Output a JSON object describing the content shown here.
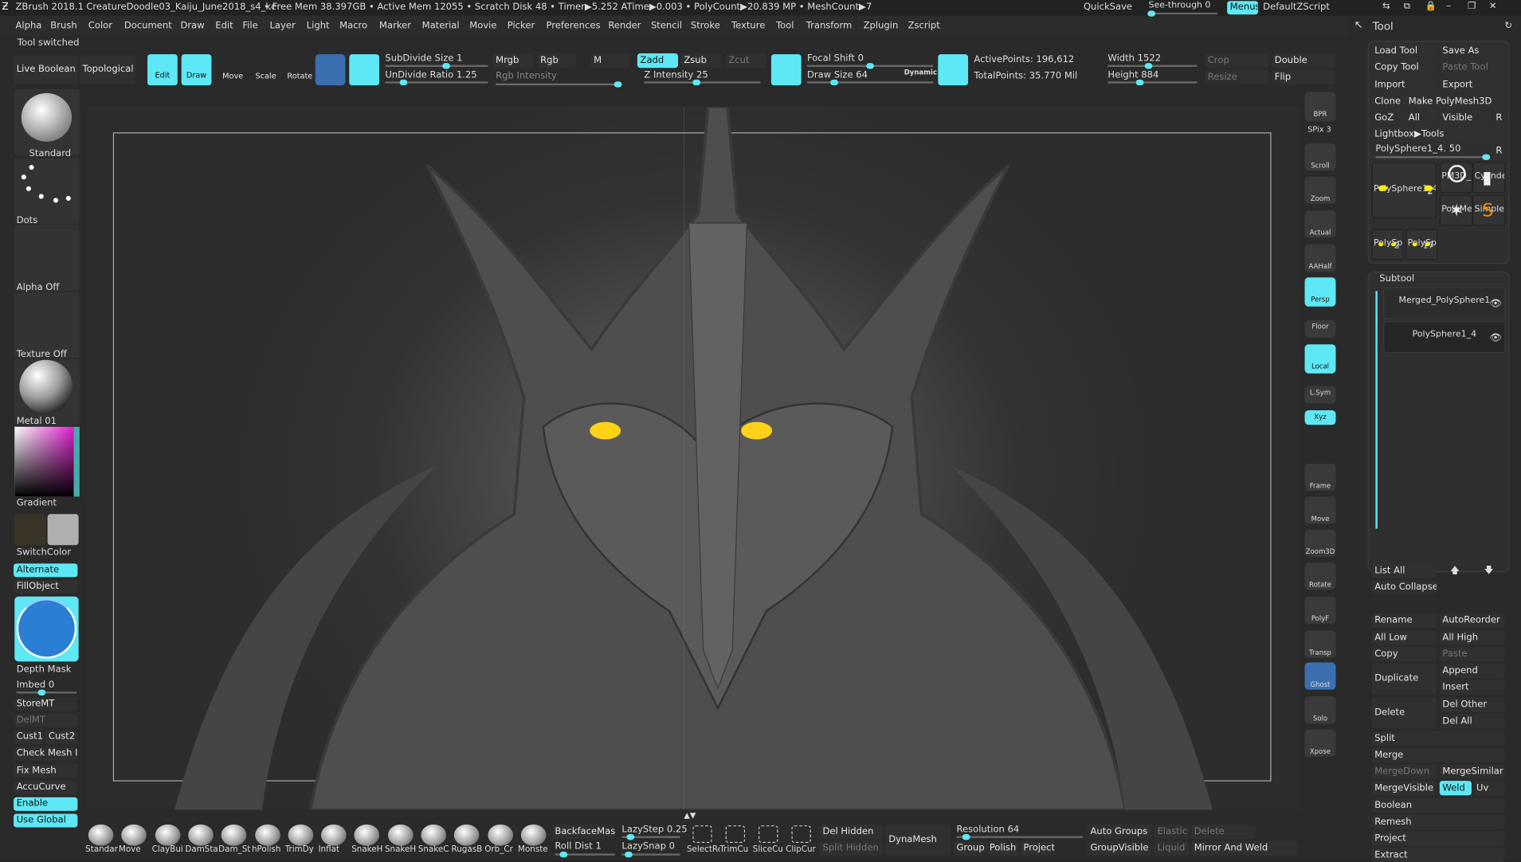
{
  "title_bar": {
    "app": "ZBrush 2018.1",
    "document": "CreatureDoodle03_Kaiju_June2018_s4_kc",
    "status": "• Free Mem 38.397GB • Active Mem 12055 • Scratch Disk 48 • Timer▶5.252 ATime▶0.003 • PolyCount▶20.839 MP • MeshCount▶7",
    "quicksave": "QuickSave",
    "see_through": "See-through  0",
    "see_through_value": 0,
    "menus": "Menus",
    "script": "DefaultZScript"
  },
  "menu": {
    "items": [
      "Alpha",
      "Brush",
      "Color",
      "Document",
      "Draw",
      "Edit",
      "File",
      "Layer",
      "Light",
      "Macro",
      "Marker",
      "Material",
      "Movie",
      "Picker",
      "Preferences",
      "Render",
      "Stencil",
      "Stroke",
      "Texture",
      "Tool",
      "Transform",
      "Zplugin",
      "Zscript"
    ],
    "tool_title": "Tool"
  },
  "notice": "Tool switched",
  "toolbar": {
    "live_boolean": "Live Boolean",
    "topological": "Topological",
    "edit": "Edit",
    "draw": "Draw",
    "move": "Move",
    "scale": "Scale",
    "rotate": "Rotate",
    "subdivide": "SubDivide Size 1",
    "undivide": "UnDivide Ratio 1.25",
    "mrgb": "Mrgb",
    "rgb": "Rgb",
    "m": "M",
    "zadd": "Zadd",
    "zsub": "Zsub",
    "zcut": "Zcut",
    "rgb_intensity": "Rgb Intensity",
    "z_intensity": "Z Intensity 25",
    "focal_shift": "Focal Shift 0",
    "draw_size": "Draw Size 64",
    "dynamic": "Dynamic",
    "active_points": "ActivePoints: 196,612",
    "total_points": "TotalPoints: 35.770 Mil",
    "width": "Width 1522",
    "height": "Height 884",
    "crop": "Crop",
    "resize": "Resize",
    "double": "Double",
    "flip": "Flip"
  },
  "left_shelf": {
    "brush": "Standard",
    "stroke": "Dots",
    "alpha": "Alpha Off",
    "texture": "Texture Off",
    "material": "Metal 01",
    "gradient": "Gradient",
    "switch_color": "SwitchColor",
    "alternate": "Alternate",
    "fill_object": "FillObject",
    "depth_mask": "Depth Mask",
    "imbed": "Imbed 0",
    "store_mt": "StoreMT",
    "del_mt": "DelMT",
    "cust1": "Cust1",
    "cust2": "Cust2",
    "check_mesh": "Check Mesh In",
    "fix_mesh": "Fix Mesh",
    "accucurve": "AccuCurve",
    "enable": "Enable",
    "use_global": "Use Global",
    "main_color": "#3a3426",
    "secondary_color": "#b0b0b0"
  },
  "right_toolbar": {
    "items": [
      "BPR",
      "SPix 3",
      "Scroll",
      "Zoom",
      "Actual",
      "AAHalf",
      "Persp",
      "Floor",
      "Local",
      "L.Sym",
      "Xyz",
      "Frame",
      "Move",
      "Zoom3D",
      "Rotate",
      "PolyF",
      "Transp",
      "Ghost",
      "Solo",
      "Xpose"
    ]
  },
  "tool_panel": {
    "load_tool": "Load Tool",
    "save_as": "Save As",
    "copy_tool": "Copy Tool",
    "paste_tool": "Paste Tool",
    "import": "Import",
    "export": "Export",
    "clone": "Clone",
    "make_polymesh": "Make PolyMesh3D",
    "goz": "GoZ",
    "all": "All",
    "visible": "Visible",
    "r": "R",
    "lightbox": "Lightbox▶Tools",
    "current_tool": "PolySphere1_4. 50",
    "thumbs": [
      {
        "label": "PolySphere1_4",
        "count": "2"
      },
      {
        "label": "PM3D_F",
        "count": "6"
      },
      {
        "label": "Cylinde"
      },
      {
        "label": "PolyMe"
      },
      {
        "label": "SimpleE"
      },
      {
        "label": "PolySpl",
        "count": "2"
      },
      {
        "label": "PolySpl",
        "count": "17"
      }
    ],
    "subtool_title": "Subtool",
    "subtools": [
      "Merged_PolySphere1",
      "PolySphere1_4"
    ],
    "list_all": "List All",
    "auto_collapse": "Auto Collapse",
    "rename": "Rename",
    "auto_reorder": "AutoReorder",
    "all_low": "All Low",
    "all_high": "All High",
    "copy": "Copy",
    "paste": "Paste",
    "duplicate": "Duplicate",
    "append": "Append",
    "insert": "Insert",
    "delete": "Delete",
    "del_other": "Del Other",
    "del_all": "Del All",
    "split": "Split",
    "merge": "Merge",
    "merge_down": "MergeDown",
    "merge_similar": "MergeSimilar",
    "merge_visible": "MergeVisible",
    "weld": "Weld",
    "uv": "Uv",
    "boolean": "Boolean",
    "remesh": "Remesh",
    "project": "Project",
    "extract": "Extract"
  },
  "bottom_shelf": {
    "brushes": [
      "Standar",
      "Move",
      "ClayBui",
      "DamSta",
      "Dam_St",
      "hPolish",
      "TrimDy",
      "Inflat",
      "SnakeH",
      "SnakeH",
      "SnakeC",
      "RugasB",
      "Orb_Cr",
      "Monste"
    ],
    "backface_mask": "BackfaceMask",
    "roll_dist": "Roll Dist 1",
    "lazy_step": "LazyStep 0.25",
    "lazy_snap": "LazySnap 0",
    "select_rect": "SelectRe",
    "trim_curve": "TrimCu",
    "slice_curve": "SliceCu",
    "clip_curve": "ClipCur",
    "del_hidden": "Del Hidden",
    "split_hidden": "Split Hidden",
    "dynamesh": "DynaMesh",
    "resolution": "Resolution 64",
    "groups": "Groups",
    "polish": "Polish",
    "project": "Project",
    "auto_groups": "Auto Groups",
    "elastic": "Elastic",
    "delete": "Delete",
    "group_visible": "GroupVisible",
    "liquid": "Liquid",
    "mirror_weld": "Mirror And Weld"
  },
  "colors": {
    "accent": "#5ee8f5",
    "eye": "#ffd21a"
  }
}
